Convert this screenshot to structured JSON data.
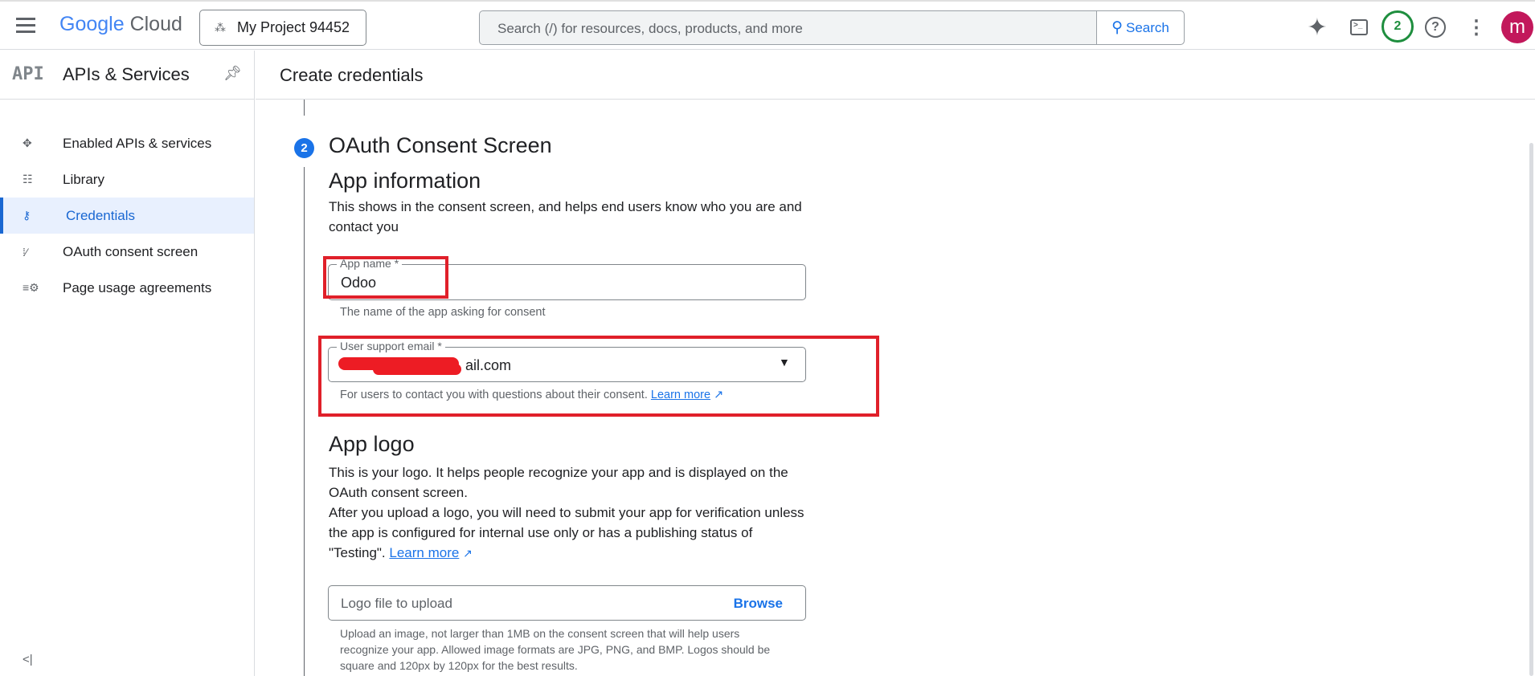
{
  "header": {
    "brand_google": "Google",
    "brand_cloud": "Cloud",
    "project": "My Project 94452",
    "search_placeholder": "Search (/) for resources, docs, products, and more",
    "search_button": "Search",
    "notification_count": "2",
    "avatar_initial": "m"
  },
  "sidebar": {
    "badge": "API",
    "title": "APIs & Services",
    "items": [
      {
        "label": "Enabled APIs & services"
      },
      {
        "label": "Library"
      },
      {
        "label": "Credentials",
        "active": true
      },
      {
        "label": "OAuth consent screen"
      },
      {
        "label": "Page usage agreements"
      }
    ],
    "collapse": "<|"
  },
  "page": {
    "title": "Create credentials"
  },
  "step": {
    "number": "2",
    "title": "OAuth Consent Screen"
  },
  "app_info": {
    "heading": "App information",
    "desc": "This shows in the consent screen, and helps end users know who you are and contact you",
    "app_name": {
      "label": "App name *",
      "value": "Odoo",
      "help": "The name of the app asking for consent"
    },
    "support_email": {
      "label": "User support email *",
      "value": "ail.com",
      "help": "For users to contact you with questions about their consent.",
      "learn_more": "Learn more"
    }
  },
  "app_logo": {
    "heading": "App logo",
    "desc1": "This is your logo. It helps people recognize your app and is displayed on the OAuth consent screen.",
    "desc2": "After you upload a logo, you will need to submit your app for verification unless the app is configured for internal use only or has a publishing status of \"Testing\".",
    "learn_more": "Learn more",
    "upload_placeholder": "Logo file to upload",
    "browse": "Browse",
    "upload_help": "Upload an image, not larger than 1MB on the consent screen that will help users recognize your app. Allowed image formats are JPG, PNG, and BMP. Logos should be square and 120px by 120px for the best results."
  },
  "colors": {
    "accent": "#1a73e8",
    "highlight": "#e0202a",
    "avatar": "#c2185b"
  }
}
